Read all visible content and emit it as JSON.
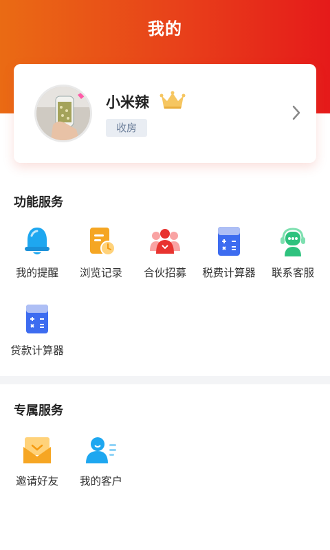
{
  "header": {
    "title": "我的"
  },
  "profile": {
    "name": "小米辣",
    "role": "收房",
    "avatar_icon": "avatar-photo",
    "level_icon": "crown-icon"
  },
  "function_services": {
    "title": "功能服务",
    "items": [
      {
        "label": "我的提醒",
        "icon": "bell-icon",
        "color": "#1ea7f0"
      },
      {
        "label": "浏览记录",
        "icon": "history-icon",
        "color": "#f5a623"
      },
      {
        "label": "合伙招募",
        "icon": "people-icon",
        "color": "#f05050"
      },
      {
        "label": "税费计算器",
        "icon": "calculator-icon",
        "color": "#3d6cf0"
      },
      {
        "label": "联系客服",
        "icon": "robot-service-icon",
        "color": "#2ec27e"
      },
      {
        "label": "贷款计算器",
        "icon": "calculator-icon",
        "color": "#3d6cf0"
      }
    ]
  },
  "exclusive_services": {
    "title": "专属服务",
    "items": [
      {
        "label": "邀请好友",
        "icon": "envelope-icon",
        "color": "#f6a623"
      },
      {
        "label": "我的客户",
        "icon": "customer-icon",
        "color": "#1ea7f0"
      }
    ]
  }
}
